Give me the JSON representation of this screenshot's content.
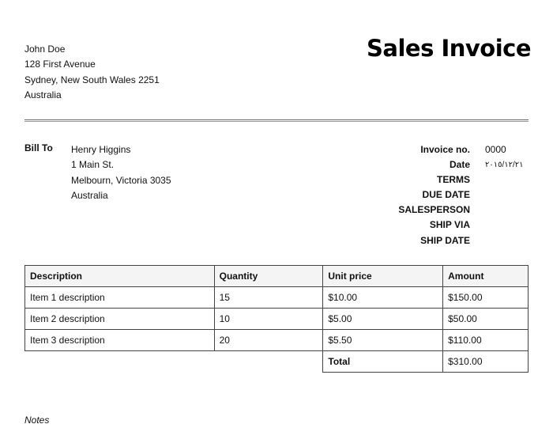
{
  "sender": {
    "name": "John Doe",
    "address_line1": "128 First Avenue",
    "address_line2": "Sydney, New South Wales 2251",
    "country": "Australia"
  },
  "document": {
    "title": "Sales Invoice"
  },
  "bill_to": {
    "label": "Bill To",
    "name": "Henry Higgins",
    "address_line1": "1 Main St.",
    "address_line2": "Melbourn, Victoria 3035",
    "country": "Australia"
  },
  "invoice_meta": {
    "invoice_no_label": "Invoice no.",
    "invoice_no_value": "0000",
    "date_label": "Date",
    "date_value": "٢٠١٥/١٢/٢١",
    "terms_label": "TERMS",
    "due_date_label": "DUE DATE",
    "salesperson_label": "SALESPERSON",
    "ship_via_label": "SHIP VIA",
    "ship_date_label": "SHIP DATE"
  },
  "items_table": {
    "headers": [
      "Description",
      "Quantity",
      "Unit price",
      "Amount"
    ],
    "rows": [
      [
        "Item 1 description",
        "15",
        "$10.00",
        "$150.00"
      ],
      [
        "Item 2 description",
        "10",
        "$5.00",
        "$50.00"
      ],
      [
        "Item 3 description",
        "20",
        "$5.50",
        "$110.00"
      ]
    ],
    "total_label": "Total",
    "total_value": "$310.00"
  },
  "notes": {
    "label": "Notes"
  }
}
